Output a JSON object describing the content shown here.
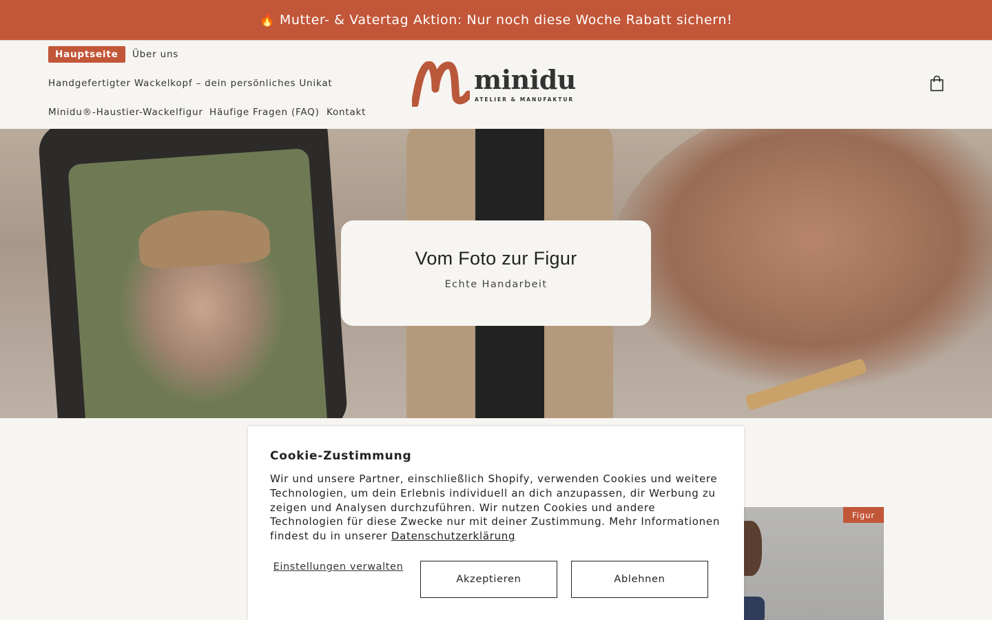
{
  "announcement": {
    "icon": "fire-icon",
    "text": "🔥",
    "message": "Mutter- & Vatertag Aktion: Nur noch diese Woche Rabatt sichern!"
  },
  "header": {
    "nav": [
      {
        "label": "Hauptseite",
        "active": true
      },
      {
        "label": "Über uns"
      },
      {
        "label": "Handgefertigter Wackelkopf – dein persönliches Unikat"
      },
      {
        "label": "Minidu®-Haustier-Wackelfigur"
      },
      {
        "label": "Häufige Fragen (FAQ)"
      },
      {
        "label": "Kontakt"
      }
    ],
    "logo": {
      "wordmark": "minidu",
      "tagline": "ATELIER & MANUFAKTUR"
    },
    "cart_icon": "shopping-bag-icon"
  },
  "hero": {
    "title": "Vom Foto zur Figur",
    "subtitle": "Echte Handarbeit"
  },
  "product": {
    "badge": "Figur"
  },
  "cookie": {
    "title": "Cookie-Zustimmung",
    "text": "Wir und unsere Partner, einschließlich Shopify, verwenden Cookies und weitere Technologien, um dein Erlebnis individuell an dich anzupassen, dir Werbung zu zeigen und Analysen durchzuführen. Wir nutzen Cookies und andere Technologien für diese Zwecke nur mit deiner Zustimmung. Mehr Informationen findest du in unserer",
    "link": "Datenschutzerklärung",
    "manage": "Einstellungen verwalten",
    "accept": "Akzeptieren",
    "decline": "Ablehnen"
  },
  "colors": {
    "accent": "#c25638",
    "background": "#f7f5f2"
  }
}
